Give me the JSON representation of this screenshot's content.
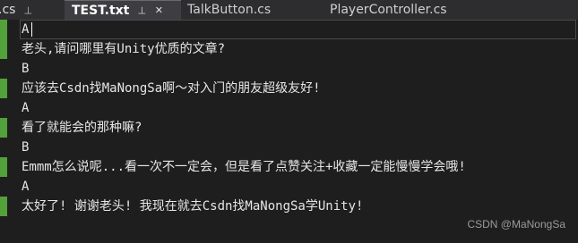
{
  "tabs": [
    {
      "label": ".cs",
      "state": "partial",
      "button": "pin-icon"
    },
    {
      "label": "TEST.txt",
      "state": "active",
      "button": "close-icon"
    },
    {
      "label": "TalkButton.cs",
      "state": "inactive",
      "button": "none"
    },
    {
      "label": "PlayerController.cs",
      "state": "inactive",
      "button": "none"
    }
  ],
  "close_glyph": "✕",
  "pin_glyph": "⊣",
  "editor": {
    "lines": [
      {
        "text": "A",
        "changed": true,
        "current": true
      },
      {
        "text": "老头,请问哪里有Unity优质的文章?",
        "changed": true
      },
      {
        "text": "B",
        "changed": false
      },
      {
        "text": "应该去Csdn找MaNongSa啊～对入门的朋友超级友好!",
        "changed": true
      },
      {
        "text": "A",
        "changed": false
      },
      {
        "text": "看了就能会的那种嘛?",
        "changed": true
      },
      {
        "text": "B",
        "changed": false
      },
      {
        "text": "Emmm怎么说呢...看一次不一定会，但是看了点赞关注+收藏一定能慢慢学会哦!",
        "changed": true
      },
      {
        "text": "A",
        "changed": false
      },
      {
        "text": "太好了! 谢谢老头! 我现在就去Csdn找MaNongSa学Unity!",
        "changed": true
      }
    ]
  },
  "watermark": "CSDN @MaNongSa",
  "colors": {
    "background": "#1e1e1e",
    "tab_bar": "#2d2d30",
    "active_tab": "#3e3e42",
    "change_marker": "#53a13a",
    "text": "#e6e6e6"
  }
}
